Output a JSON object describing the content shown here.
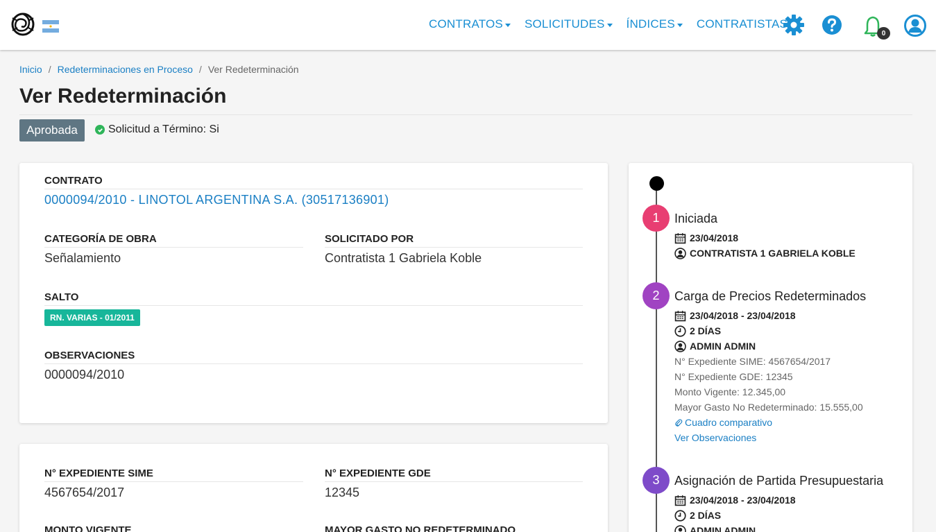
{
  "nav": {
    "items": [
      {
        "label": "CONTRATOS"
      },
      {
        "label": "SOLICITUDES"
      },
      {
        "label": "ÍNDICES"
      },
      {
        "label": "CONTRATISTAS"
      }
    ],
    "notifications_count": "0",
    "icons": [
      "gear-icon",
      "help-icon",
      "bell-icon",
      "user-icon"
    ],
    "accent_color": "#1a8fd3"
  },
  "breadcrumb": {
    "items": [
      "Inicio",
      "Redeterminaciones en Proceso",
      "Ver Redeterminación"
    ]
  },
  "page": {
    "title": "Ver Redeterminación",
    "status": "Aprobada",
    "termino_label": "Solicitud a Término: Si"
  },
  "contrato": {
    "label": "CONTRATO",
    "value": "0000094/2010 - LINOTOL ARGENTINA S.A. (30517136901)"
  },
  "categoria": {
    "label": "CATEGORÍA DE OBRA",
    "value": "Señalamiento"
  },
  "solicitado": {
    "label": "SOLICITADO POR",
    "value": "Contratista 1 Gabriela Koble"
  },
  "salto": {
    "label": "SALTO",
    "value": "RN. VARIAS - 01/2011"
  },
  "observaciones": {
    "label": "OBSERVACIONES",
    "value": "0000094/2010"
  },
  "expedientes": {
    "sime_label": "N° EXPEDIENTE SIME",
    "sime_value": "4567654/2017",
    "gde_label": "N° EXPEDIENTE GDE",
    "gde_value": "12345",
    "monto_label": "MONTO VIGENTE",
    "mayor_label": "MAYOR GASTO NO REDETERMINADO"
  },
  "timeline": {
    "steps": [
      {
        "number": "1",
        "title": "Iniciada",
        "date": "23/04/2018",
        "user": "CONTRATISTA 1 GABRIELA KOBLE",
        "color": "#e83e72"
      },
      {
        "number": "2",
        "title": "Carga de Precios Redeterminados",
        "date": "23/04/2018 - 23/04/2018",
        "duration": "2 DÍAS",
        "user": "ADMIN ADMIN",
        "details": [
          "N° Expediente SIME: 4567654/2017",
          "N° Expediente GDE: 12345",
          "Monto Vigente: 12.345,00",
          "Mayor Gasto No Redeterminado: 15.555,00"
        ],
        "link_cuadro": "Cuadro comparativo",
        "link_obs": "Ver Observaciones",
        "color": "#a043c2"
      },
      {
        "number": "3",
        "title": "Asignación de Partida Presupuestaria",
        "date": "23/04/2018 - 23/04/2018",
        "duration": "2 DÍAS",
        "user": "ADMIN ADMIN",
        "color": "#7e4bc9"
      }
    ]
  }
}
